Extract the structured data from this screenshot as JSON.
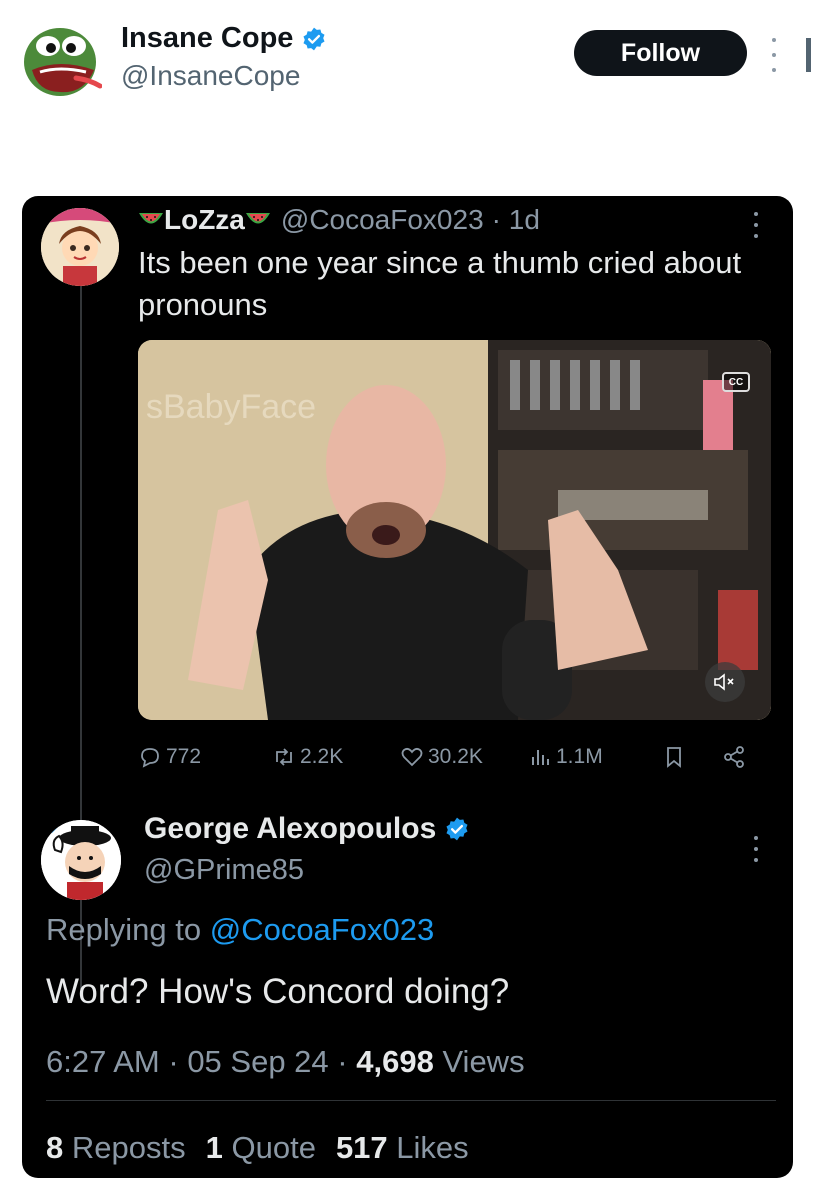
{
  "quoting_account": {
    "name": "Insane Cope",
    "handle": "@InsaneCope",
    "follow_label": "Follow",
    "verified": true
  },
  "original_tweet": {
    "author_name": "LoZza",
    "handle": "@CocoaFox023",
    "time": "· 1d",
    "text": "Its been one year since a thumb cried about pronouns",
    "media": {
      "type": "video",
      "watermark_text": "sBabyFace",
      "cc_label": "CC"
    },
    "actions": {
      "replies": "772",
      "reposts": "2.2K",
      "likes": "30.2K",
      "views": "1.1M"
    }
  },
  "reply_tweet": {
    "author_name": "George Alexopoulos",
    "handle": "@GPrime85",
    "verified": true,
    "replying_prefix": "Replying to",
    "replying_to": "@CocoaFox023",
    "text": "Word? How's Concord doing?",
    "time": "6:27 AM",
    "date": "05 Sep 24",
    "views_count": "4,698",
    "views_label": "Views",
    "reposts_count": "8",
    "reposts_label": "Reposts",
    "quotes_count": "1",
    "quotes_label": "Quote",
    "likes_count": "517",
    "likes_label": "Likes"
  },
  "colors": {
    "accent": "#1d9bf0",
    "card_bg": "#000000",
    "muted_text": "#8b98a5"
  }
}
